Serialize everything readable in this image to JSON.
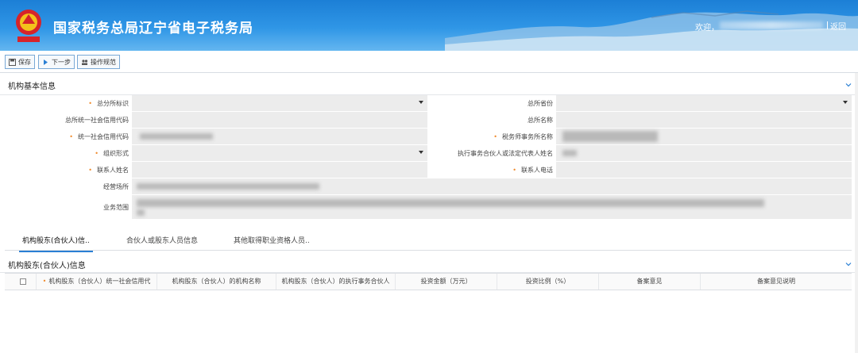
{
  "header": {
    "title": "国家税务总局辽宁省电子税务局",
    "welcome": "欢迎，",
    "return": "返回"
  },
  "toolbar": {
    "save": "保存",
    "next": "下一步",
    "guide": "操作规范"
  },
  "basic_section": {
    "title": "机构基本信息",
    "labels": {
      "hq_branch": "总分所标识",
      "hq_province": "总所省份",
      "hq_credit_code": "总所统一社会信用代码",
      "hq_name": "总所名称",
      "credit_code": "统一社会信用代码",
      "firm_name": "税务师事务所名称",
      "org_form": "组织形式",
      "exec_partner": "执行事务合伙人或法定代表人姓名",
      "contact_name": "联系人姓名",
      "contact_phone": "联系人电话",
      "address": "经营场所",
      "scope": "业务范围"
    }
  },
  "tabs": [
    "机构股东(合伙人)信..",
    "合伙人或股东人员信息",
    "其他取得职业资格人员.."
  ],
  "shareholder_section": {
    "title": "机构股东(合伙人)信息",
    "columns": [
      "机构股东（合伙人）统一社会信用代",
      "机构股东（合伙人）的机构名称",
      "机构股东（合伙人）的执行事务合伙人",
      "投资金额（万元）",
      "投资比例（%）",
      "备案意见",
      "备案意见说明"
    ]
  },
  "colors": {
    "accent": "#2a7fd4",
    "required": "#f08a2c",
    "header_top": "#1c7fd6"
  }
}
